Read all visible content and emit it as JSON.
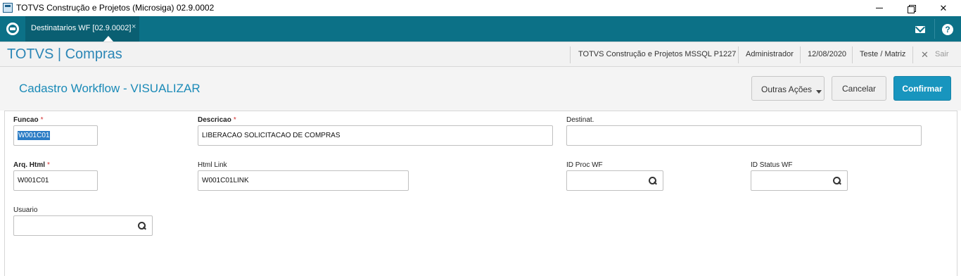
{
  "window": {
    "title": "TOTVS Construção e Projetos (Microsiga) 02.9.0002"
  },
  "appbar": {
    "tab_label": "Destinatarios WF [02.9.0002]",
    "tab_close": "×",
    "help": "?"
  },
  "header": {
    "brand": "TOTVS | Compras",
    "company": "TOTVS Construção e Projetos MSSQL P1227",
    "user": "Administrador",
    "date": "12/08/2020",
    "branch": "Teste / Matriz",
    "exit": "Sair"
  },
  "toolbar": {
    "title": "Cadastro Workflow - VISUALIZAR",
    "other_actions": "Outras Ações",
    "cancel": "Cancelar",
    "confirm": "Confirmar"
  },
  "form": {
    "funcao": {
      "label": "Funcao",
      "required": "*",
      "value": "W001C01"
    },
    "descricao": {
      "label": "Descricao",
      "required": "*",
      "value": "LIBERACAO SOLICITACAO DE COMPRAS"
    },
    "destinat": {
      "label": "Destinat.",
      "value": ""
    },
    "arq_html": {
      "label": "Arq. Html",
      "required": "*",
      "value": "W001C01"
    },
    "html_link": {
      "label": "Html Link",
      "value": "W001C01LINK"
    },
    "id_proc_wf": {
      "label": "ID Proc WF",
      "value": ""
    },
    "id_status_wf": {
      "label": "ID Status WF",
      "value": ""
    },
    "usuario": {
      "label": "Usuario",
      "value": ""
    }
  },
  "colors": {
    "appbar": "#0c7187",
    "brand": "#2b86b6",
    "confirm": "#1895be",
    "required": "#d32f2f"
  },
  "icons": [
    "app-window-icon",
    "totvs-logo-icon",
    "mail-icon",
    "help-icon",
    "close-icon",
    "search-icon",
    "chevron-down-icon"
  ]
}
